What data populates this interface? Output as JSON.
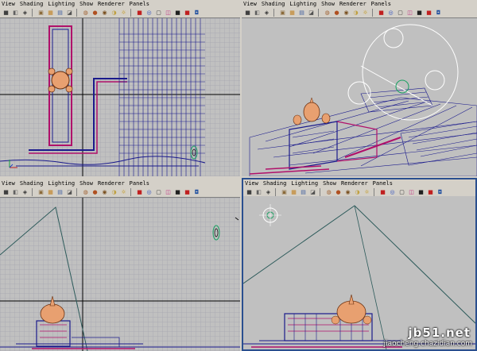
{
  "menu": [
    "View",
    "Shading",
    "Lighting",
    "Show",
    "Renderer",
    "Panels"
  ],
  "toolbar_icons": [
    {
      "name": "camera-icon",
      "glyph": "■",
      "color": "#404040"
    },
    {
      "name": "camera-attributes-icon",
      "glyph": "◧",
      "color": "#606060"
    },
    {
      "name": "bookmark-icon",
      "glyph": "◈",
      "color": "#303030"
    },
    {
      "sep": true
    },
    {
      "name": "image-plane-icon",
      "glyph": "▣",
      "color": "#8a6a3a"
    },
    {
      "name": "grid-icon",
      "glyph": "▦",
      "color": "#c08020"
    },
    {
      "name": "film-gate-icon",
      "glyph": "▤",
      "color": "#4060a0"
    },
    {
      "name": "resolution-gate-icon",
      "glyph": "◪",
      "color": "#505050"
    },
    {
      "sep": true
    },
    {
      "name": "wireframe-icon",
      "glyph": "◍",
      "color": "#a06030"
    },
    {
      "name": "smooth-shade-icon",
      "glyph": "●",
      "color": "#b05020"
    },
    {
      "name": "wireframe-on-shaded-icon",
      "glyph": "◉",
      "color": "#7a5020"
    },
    {
      "name": "textured-icon",
      "glyph": "◑",
      "color": "#c0a040"
    },
    {
      "name": "lights-icon",
      "glyph": "☼",
      "color": "#c09000"
    },
    {
      "sep": true
    },
    {
      "name": "shadows-icon",
      "glyph": "■",
      "color": "#c02020"
    },
    {
      "name": "xray-icon",
      "glyph": "◎",
      "color": "#3050c0"
    },
    {
      "name": "isolate-icon",
      "glyph": "▢",
      "color": "#303030"
    },
    {
      "name": "xray-joints-icon",
      "glyph": "◫",
      "color": "#c03080"
    },
    {
      "name": "render-icon",
      "glyph": "■",
      "color": "#202020"
    },
    {
      "name": "hq-render-icon",
      "glyph": "■",
      "color": "#c02020"
    },
    {
      "name": "resolution-icon",
      "glyph": "◘",
      "color": "#2050a0"
    }
  ],
  "colors": {
    "viewport_bg": "#c0c0c0",
    "grid_minor": "#9a9aa6",
    "grid_axis": "#000000",
    "wire_blue": "#1a1a8c",
    "wire_magenta": "#b0106a",
    "dome_orange": "#e8a070",
    "selection_frame": "#2a4f8f",
    "light_guide": "#2c5a5a"
  },
  "watermark": {
    "main": "jb51.net",
    "sub": "jiaocheng.chazidian.com"
  }
}
